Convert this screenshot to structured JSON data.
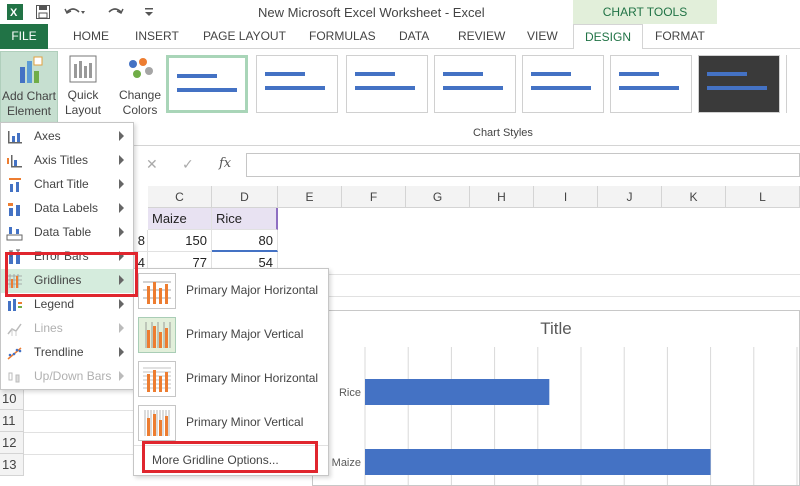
{
  "title_bar": {
    "app_title": "New Microsoft Excel Worksheet - Excel",
    "context_label": "CHART TOOLS",
    "qat_icons": [
      "excel-logo-icon",
      "save-icon",
      "undo-icon",
      "redo-icon",
      "customize-qat-icon"
    ]
  },
  "tabs": {
    "file": "FILE",
    "home": "HOME",
    "insert": "INSERT",
    "page_layout": "PAGE LAYOUT",
    "formulas": "FORMULAS",
    "data": "DATA",
    "review": "REVIEW",
    "view": "VIEW",
    "design": "DESIGN",
    "format": "FORMAT"
  },
  "ribbon": {
    "add_chart_element_line1": "Add Chart",
    "add_chart_element_line2": "Element",
    "quick_layout_line1": "Quick",
    "quick_layout_line2": "Layout",
    "change_colors_line1": "Change",
    "change_colors_line2": "Colors",
    "chart_styles_label": "Chart Styles"
  },
  "formula_bar": {
    "cancel_symbol": "✕",
    "enter_symbol": "✓",
    "fx_symbol": "fx",
    "value": ""
  },
  "columns": [
    "C",
    "D",
    "E",
    "F",
    "G",
    "H",
    "I",
    "J",
    "K",
    "L"
  ],
  "cells": {
    "c1": "Maize",
    "d1": "Rice",
    "b2": "8",
    "c2": "150",
    "d2": "80",
    "b3": "4",
    "c3": "77",
    "d3": "54"
  },
  "rows": [
    "10",
    "11",
    "12",
    "13"
  ],
  "menu": {
    "items": [
      {
        "label": "Axes",
        "icon": "axes-icon",
        "enabled": true
      },
      {
        "label": "Axis Titles",
        "icon": "axis-titles-icon",
        "enabled": true
      },
      {
        "label": "Chart Title",
        "icon": "chart-title-icon",
        "enabled": true
      },
      {
        "label": "Data Labels",
        "icon": "data-labels-icon",
        "enabled": true
      },
      {
        "label": "Data Table",
        "icon": "data-table-icon",
        "enabled": true
      },
      {
        "label": "Error Bars",
        "icon": "error-bars-icon",
        "enabled": true
      },
      {
        "label": "Gridlines",
        "icon": "gridlines-icon",
        "enabled": true
      },
      {
        "label": "Legend",
        "icon": "legend-icon",
        "enabled": true
      },
      {
        "label": "Lines",
        "icon": "lines-icon",
        "enabled": false
      },
      {
        "label": "Trendline",
        "icon": "trendline-icon",
        "enabled": true
      },
      {
        "label": "Up/Down Bars",
        "icon": "up-down-bars-icon",
        "enabled": false
      }
    ]
  },
  "submenu": {
    "items": [
      {
        "label": "Primary Major Horizontal",
        "active": false
      },
      {
        "label": "Primary Major Vertical",
        "active": true
      },
      {
        "label": "Primary Minor Horizontal",
        "active": false
      },
      {
        "label": "Primary Minor Vertical",
        "active": false
      }
    ],
    "more_options": "More Gridline Options..."
  },
  "colors": {
    "excel_green": "#217346",
    "context_tab_bg": "#e2efda",
    "bar_color": "#4472c4",
    "highlight_red": "#e0262e"
  },
  "chart_data": {
    "type": "bar",
    "title": "Title",
    "categories": [
      "Rice",
      "Maize"
    ],
    "values": [
      80,
      150
    ],
    "orientation": "horizontal",
    "grid": true
  }
}
